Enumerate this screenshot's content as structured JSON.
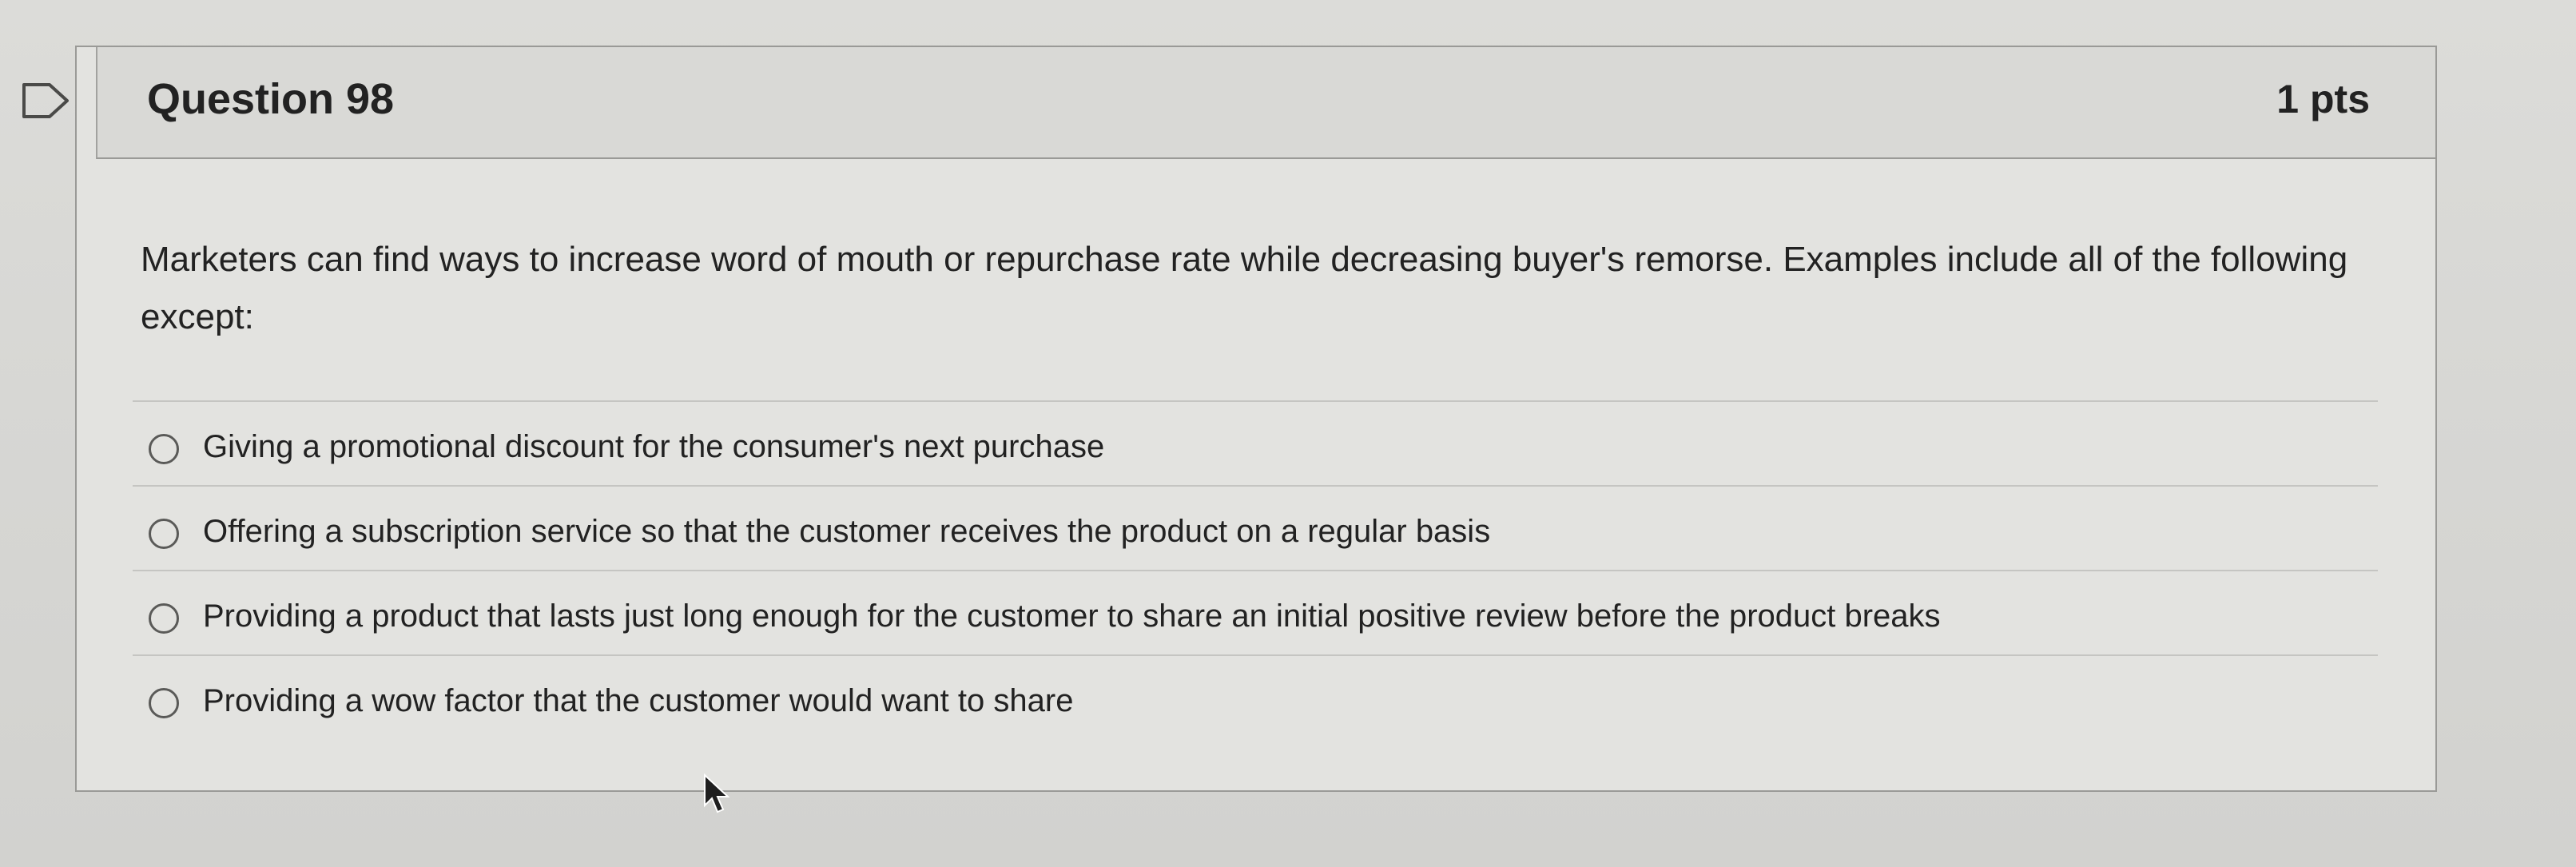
{
  "question": {
    "title": "Question 98",
    "points": "1 pts",
    "text": "Marketers can find ways to increase word of mouth or repurchase rate while decreasing buyer's remorse. Examples include all of the following except:"
  },
  "answers": [
    {
      "label": "Giving a promotional discount for the consumer's next purchase"
    },
    {
      "label": "Offering a subscription service so that the customer receives the product on a regular basis"
    },
    {
      "label": "Providing a product that lasts just long enough for the customer to share an initial positive review before the product breaks"
    },
    {
      "label": "Providing a wow factor that the customer would want to share"
    }
  ],
  "icons": {
    "flag": "flag-icon",
    "cursor": "mouse-cursor-icon"
  }
}
